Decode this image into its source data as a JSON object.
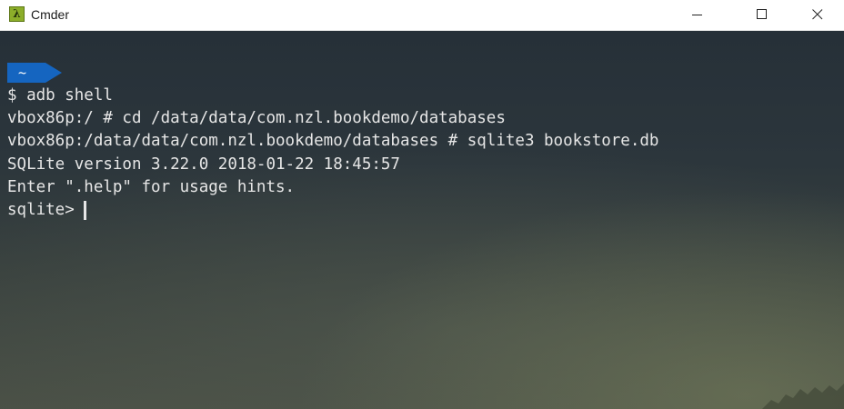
{
  "window": {
    "title": "Cmder",
    "app_icon_glyph": "λ",
    "app_icon_color": "#8cae2a",
    "controls": [
      "minimize-icon",
      "maximize-icon",
      "close-icon"
    ]
  },
  "terminal": {
    "prompt_badge": "~",
    "prompt_badge_color": "#1565c0",
    "lines": [
      "$ adb shell",
      "vbox86p:/ # cd /data/data/com.nzl.bookdemo/databases",
      "vbox86p:/data/data/com.nzl.bookdemo/databases # sqlite3 bookstore.db",
      "SQLite version 3.22.0 2018-01-22 18:45:57",
      "Enter \".help\" for usage hints."
    ],
    "current_prompt": "sqlite>",
    "text_color": "#e6e6e6"
  }
}
